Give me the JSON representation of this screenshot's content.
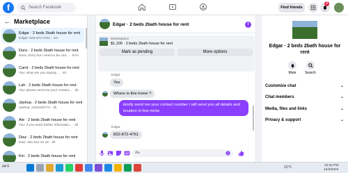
{
  "topbar": {
    "logo": "f",
    "search_placeholder": "Search Facebook",
    "find_friends_label": "Find friends",
    "notification_count": "2"
  },
  "sidebar": {
    "title": "Marketplace",
    "conversations": [
      {
        "title": "Edgar · 2 beds 2bath house for rent",
        "subtitle": "Edgar: 832-872-4761 · 1m"
      },
      {
        "title": "Dora · 2 beds 2bath house for rent",
        "subtitle": "Dora: Sorry but i need to be cert... · 57m"
      },
      {
        "title": "Carol · 2 beds 2bath house for rent",
        "subtitle": "You: what are you saying.... · 4h"
      },
      {
        "title": "Lah · 2 beds 2bath house for rent",
        "subtitle": "You: please send me your contact... · 3h"
      },
      {
        "title": "Jashua · 2 beds 2bath house for rent",
        "subtitle": "Jashua: 2164183774 · 3h"
      },
      {
        "title": "Ale · 2 beds 2bath house for rent",
        "subtitle": "You: if you need further informatio... · 3h"
      },
      {
        "title": "Diaz · 2 beds 2bath house for rent",
        "subtitle": "Diaz: 281 614 22 16 · 4h"
      },
      {
        "title": "Kiri · 2 beds 2bath house for rent",
        "subtitle": ""
      }
    ]
  },
  "chat": {
    "title": "Edgar · 2 beds 2bath house for rent",
    "info_icon": "i",
    "listing": {
      "label": "Marketplace",
      "price": "$1,100 · 2 beds 2bath house for rent",
      "mark_pending_label": "Mark as pending",
      "more_options_label": "More options"
    },
    "messages": [
      {
        "sender": "Edgar",
        "text": "Yes"
      },
      {
        "text": "Where is this home ?"
      },
      {
        "text": "kindly send me your contact number i will send you all details and location  in few mints"
      },
      {
        "sender": "Edgar",
        "text": "832-872-4761"
      }
    ],
    "composer_placeholder": "Aa"
  },
  "rightpanel": {
    "title": "Edgar · 2 beds 2bath house for rent",
    "mute_label": "Mute",
    "search_label": "Search",
    "sections": [
      "Customize chat",
      "Chat members",
      "Media, files and links",
      "Privacy & support"
    ]
  },
  "taskbar": {
    "weather": "44°F",
    "tray": "12°C",
    "time": "10:31 PM",
    "date": "12/2/2023"
  },
  "colors": {
    "accent": "#8a3ffc",
    "facebook_blue": "#1877f2",
    "badge": "#e41e3f"
  }
}
